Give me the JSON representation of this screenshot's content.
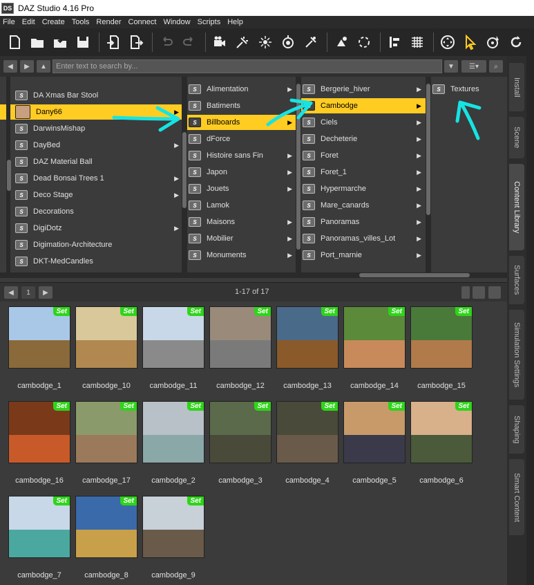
{
  "window": {
    "logo": "DS",
    "title": "DAZ Studio 4.16 Pro"
  },
  "menu": [
    "File",
    "Edit",
    "Create",
    "Tools",
    "Render",
    "Connect",
    "Window",
    "Scripts",
    "Help"
  ],
  "search": {
    "placeholder": "Enter text to search by..."
  },
  "side_tabs": [
    "Install",
    "Scene",
    "Content Library",
    "Surfaces",
    "Simulation Settings",
    "Shaping",
    "Smart Content"
  ],
  "tree": {
    "col1": [
      {
        "label": "DA Xmas Bar Stool",
        "arrow": false
      },
      {
        "label": "Dany66",
        "arrow": true,
        "selected": true,
        "avatar": true
      },
      {
        "label": "DarwinsMishap",
        "arrow": false
      },
      {
        "label": "DayBed",
        "arrow": true
      },
      {
        "label": "DAZ Material Ball",
        "arrow": false
      },
      {
        "label": "Dead Bonsai Trees 1",
        "arrow": true
      },
      {
        "label": "Deco Stage",
        "arrow": true
      },
      {
        "label": "Decorations",
        "arrow": false
      },
      {
        "label": "DigiDotz",
        "arrow": true
      },
      {
        "label": "Digimation-Architecture",
        "arrow": false
      },
      {
        "label": "DKT-MedCandles",
        "arrow": false
      }
    ],
    "col2": [
      {
        "label": "Alimentation",
        "arrow": true
      },
      {
        "label": "Batiments",
        "arrow": false
      },
      {
        "label": "Billboards",
        "arrow": true,
        "selected": true
      },
      {
        "label": "dForce",
        "arrow": false
      },
      {
        "label": "Histoire sans Fin",
        "arrow": true
      },
      {
        "label": "Japon",
        "arrow": true
      },
      {
        "label": "Jouets",
        "arrow": true
      },
      {
        "label": "Lamok",
        "arrow": false
      },
      {
        "label": "Maisons",
        "arrow": true
      },
      {
        "label": "Mobilier",
        "arrow": true
      },
      {
        "label": "Monuments",
        "arrow": true
      }
    ],
    "col3": [
      {
        "label": "Bergerie_hiver",
        "arrow": true
      },
      {
        "label": "Cambodge",
        "arrow": true,
        "selected": true
      },
      {
        "label": "Ciels",
        "arrow": true
      },
      {
        "label": "Decheterie",
        "arrow": true
      },
      {
        "label": "Foret",
        "arrow": true
      },
      {
        "label": "Foret_1",
        "arrow": true
      },
      {
        "label": "Hypermarche",
        "arrow": true
      },
      {
        "label": "Mare_canards",
        "arrow": true
      },
      {
        "label": "Panoramas",
        "arrow": true
      },
      {
        "label": "Panoramas_villes_Lot",
        "arrow": true
      },
      {
        "label": "Port_marnie",
        "arrow": true
      }
    ],
    "col4": [
      {
        "label": "Textures",
        "arrow": false
      }
    ]
  },
  "pager": {
    "page": "1",
    "count": "1-17 of 17"
  },
  "badge_label": "Set",
  "items": [
    {
      "label": "cambodge_1",
      "sky": "#a9c8e8",
      "ground": "#8a6a3a"
    },
    {
      "label": "cambodge_10",
      "sky": "#d8c89a",
      "ground": "#b08850"
    },
    {
      "label": "cambodge_11",
      "sky": "#c8d8e8",
      "ground": "#8a8a8a"
    },
    {
      "label": "cambodge_12",
      "sky": "#9a8a7a",
      "ground": "#7a7a7a"
    },
    {
      "label": "cambodge_13",
      "sky": "#4a6a8a",
      "ground": "#8a5a2a"
    },
    {
      "label": "cambodge_14",
      "sky": "#5a8a3a",
      "ground": "#c88a5a"
    },
    {
      "label": "cambodge_15",
      "sky": "#4a7a3a",
      "ground": "#b07a4a"
    },
    {
      "label": "cambodge_16",
      "sky": "#7a3a1a",
      "ground": "#c85a2a"
    },
    {
      "label": "cambodge_17",
      "sky": "#8a9a6a",
      "ground": "#9a7a5a"
    },
    {
      "label": "cambodge_2",
      "sky": "#b8c0c8",
      "ground": "#8aa8a8"
    },
    {
      "label": "cambodge_3",
      "sky": "#5a6a4a",
      "ground": "#4a4a3a"
    },
    {
      "label": "cambodge_4",
      "sky": "#4a4a3a",
      "ground": "#6a5a4a"
    },
    {
      "label": "cambodge_5",
      "sky": "#c89a6a",
      "ground": "#3a3a4a"
    },
    {
      "label": "cambodge_6",
      "sky": "#d8b08a",
      "ground": "#4a5a3a"
    },
    {
      "label": "cambodge_7",
      "sky": "#c8d8e8",
      "ground": "#4aa8a0"
    },
    {
      "label": "cambodge_8",
      "sky": "#3a6aaa",
      "ground": "#c8a04a"
    },
    {
      "label": "cambodge_9",
      "sky": "#c8d0d8",
      "ground": "#6a5a4a"
    }
  ],
  "colors": {
    "selection": "#ffcc22",
    "badge": "#2fd41a",
    "annotation": "#17e3e3"
  }
}
